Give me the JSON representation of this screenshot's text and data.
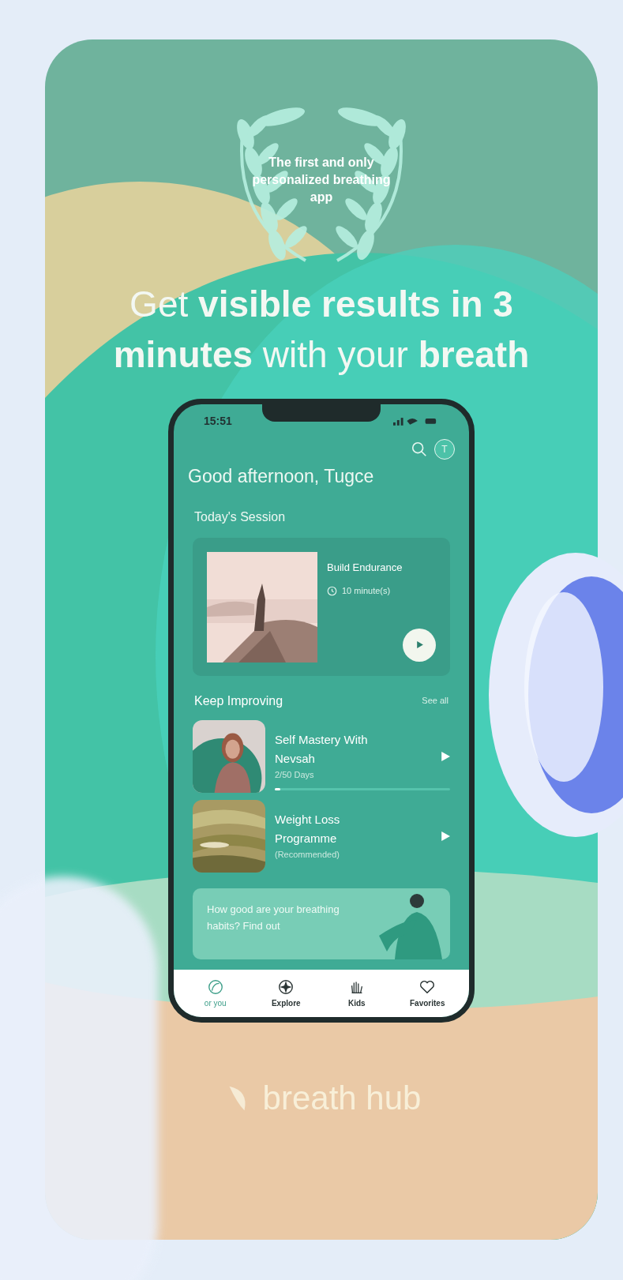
{
  "badge": {
    "text": "The first and only personalized breathing app"
  },
  "headline": "Get **visible results in 3 minutes** with your **breath**",
  "phone": {
    "status_time": "15:51",
    "avatar_initial": "T",
    "greeting": "Good afternoon, Tugce",
    "todays_session": {
      "heading": "Today's Session",
      "title": "Build Endurance",
      "duration": "10 minute(s)"
    },
    "keep_improving": {
      "heading": "Keep Improving",
      "see_all": "See all",
      "programs": [
        {
          "title": "Self Mastery With Nevsah",
          "subtitle": "2/50 Days",
          "level": 0.03,
          "kind": "progress"
        },
        {
          "title": "Weight Loss Programme",
          "subtitle": "(Recommended)",
          "kind": "plain"
        }
      ]
    },
    "promo": {
      "text": "How good are your breathing habits? Find out"
    },
    "nav": [
      {
        "label": "or you",
        "kind": "foryou",
        "selected": true
      },
      {
        "label": "Explore",
        "kind": "explore",
        "selected": false
      },
      {
        "label": "Kids",
        "kind": "kids",
        "selected": false
      },
      {
        "label": "Favorites",
        "kind": "heart",
        "selected": false
      }
    ]
  },
  "logo": "breath hub"
}
